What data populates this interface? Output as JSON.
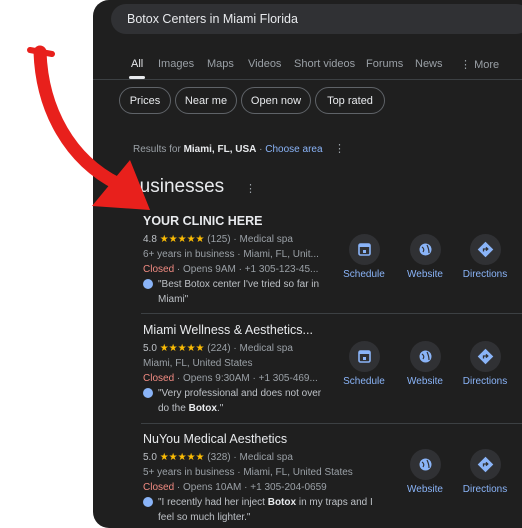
{
  "search": {
    "query": "Botox Centers in Miami Florida"
  },
  "tabs": [
    "All",
    "Images",
    "Maps",
    "Videos",
    "Short videos",
    "Forums",
    "News",
    "More"
  ],
  "more_icon_glyph": "⋮",
  "filters": [
    "Prices",
    "Near me",
    "Open now",
    "Top rated"
  ],
  "results_for": {
    "prefix": "Results for ",
    "location": "Miami, FL, USA",
    "separator": " · ",
    "link": "Choose area"
  },
  "section_title": "Businesses",
  "businesses": [
    {
      "name": "YOUR CLINIC HERE",
      "rating": "4.8",
      "stars": "★★★★★",
      "reviews": "(125)",
      "category": "Medical spa",
      "line2": "6+ years in business · Miami, FL, Unit...",
      "status": "Closed",
      "hours": " · Opens 9AM · +1 305-123-45...",
      "review_pre": "\"Best Botox center I've tried so far in",
      "review_bold": "",
      "review_post": "Miami\"",
      "actions": [
        "Schedule",
        "Website",
        "Directions"
      ]
    },
    {
      "name": "Miami Wellness & Aesthetics...",
      "rating": "5.0",
      "stars": "★★★★★",
      "reviews": "(224)",
      "category": "Medical spa",
      "line2": "Miami, FL, United States",
      "status": "Closed",
      "hours": " · Opens 9:30AM · +1 305-469...",
      "review_pre": "\"Very professional and does not over",
      "review_bold": "Botox",
      "review_post": ".\"",
      "review_post_prefix": "do the ",
      "actions": [
        "Schedule",
        "Website",
        "Directions"
      ]
    },
    {
      "name": "NuYou Medical Aesthetics",
      "rating": "5.0",
      "stars": "★★★★★",
      "reviews": "(328)",
      "category": "Medical spa",
      "line2": "5+ years in business · Miami, FL, United States",
      "status": "Closed",
      "hours": " · Opens 10AM · +1 305-204-0659",
      "review_pre": "\"I recently had her inject ",
      "review_bold": "Botox",
      "review_post": " in my traps and I",
      "review_line2": "feel so much lighter.\"",
      "actions": [
        "Website",
        "Directions"
      ]
    }
  ],
  "colors": {
    "background": "#1f1f1f",
    "accent": "#8ab4f8",
    "closed": "#f28b82",
    "star": "#fbbc04",
    "arrow": "#e8201c"
  }
}
